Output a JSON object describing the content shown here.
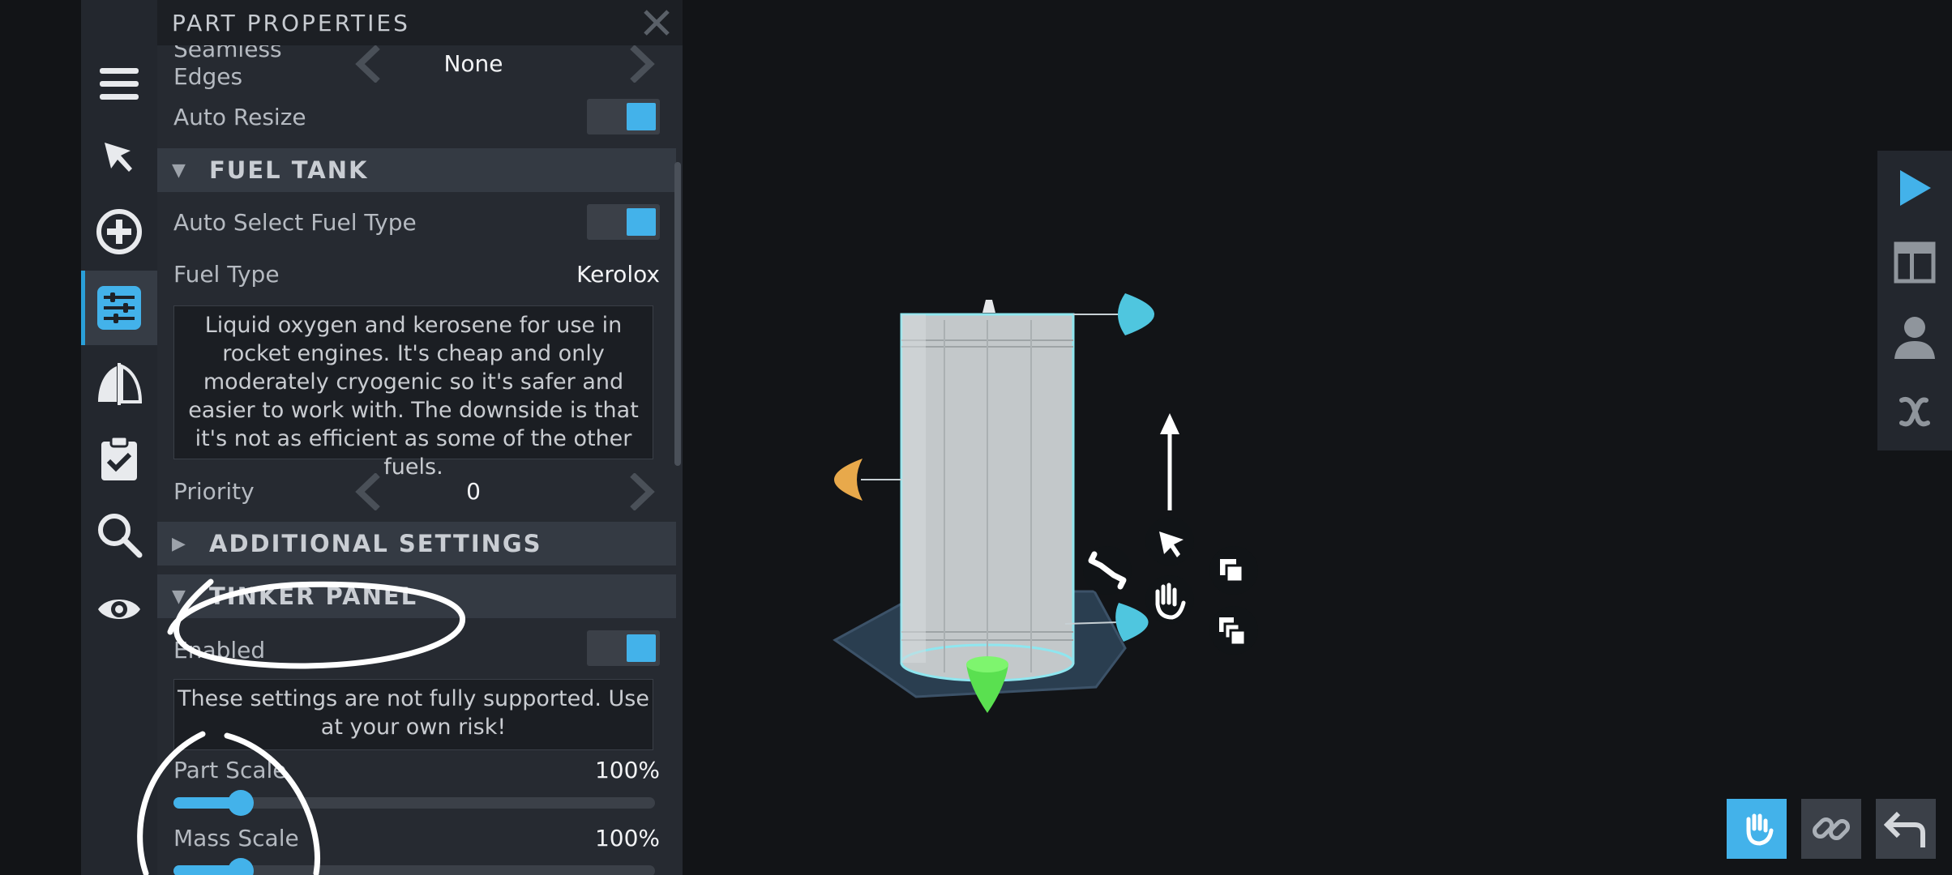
{
  "panel": {
    "title": "PART PROPERTIES",
    "seamless_edges": {
      "label": "Seamless\nEdges",
      "value": "None"
    },
    "auto_resize": {
      "label": "Auto Resize",
      "enabled": true
    },
    "fuel_tank": {
      "section_title": "FUEL TANK",
      "auto_select": {
        "label": "Auto Select Fuel Type",
        "enabled": true
      },
      "fuel_type": {
        "label": "Fuel Type",
        "value": "Kerolox"
      },
      "description": "Liquid oxygen and kerosene for use in rocket engines. It's cheap and only moderately cryogenic so it's safer and easier to work with. The downside is that it's not as efficient as some of the other fuels.",
      "priority": {
        "label": "Priority",
        "value": "0"
      }
    },
    "additional_settings": {
      "section_title": "ADDITIONAL SETTINGS"
    },
    "tinker_panel": {
      "section_title": "TINKER PANEL",
      "enabled": {
        "label": "Enabled",
        "enabled": true
      },
      "warning": "These settings are not fully supported. Use at your own risk!",
      "part_scale": {
        "label": "Part Scale",
        "value": "100%",
        "fraction": 0.14
      },
      "mass_scale": {
        "label": "Mass Scale",
        "value": "100%",
        "fraction": 0.14
      }
    }
  },
  "colors": {
    "accent": "#43b2ea",
    "panel_bg": "#262a31",
    "background": "#121417"
  },
  "toolbar_icons": [
    "menu-icon",
    "select-cursor-icon",
    "add-part-icon",
    "part-properties-icon",
    "symmetry-icon",
    "checklist-icon",
    "search-icon",
    "visibility-icon"
  ],
  "right_icons": [
    "play-icon",
    "layout-icon",
    "crew-icon",
    "variables-icon"
  ],
  "bottom_icons": [
    "hand-icon",
    "link-icon",
    "undo-icon"
  ]
}
